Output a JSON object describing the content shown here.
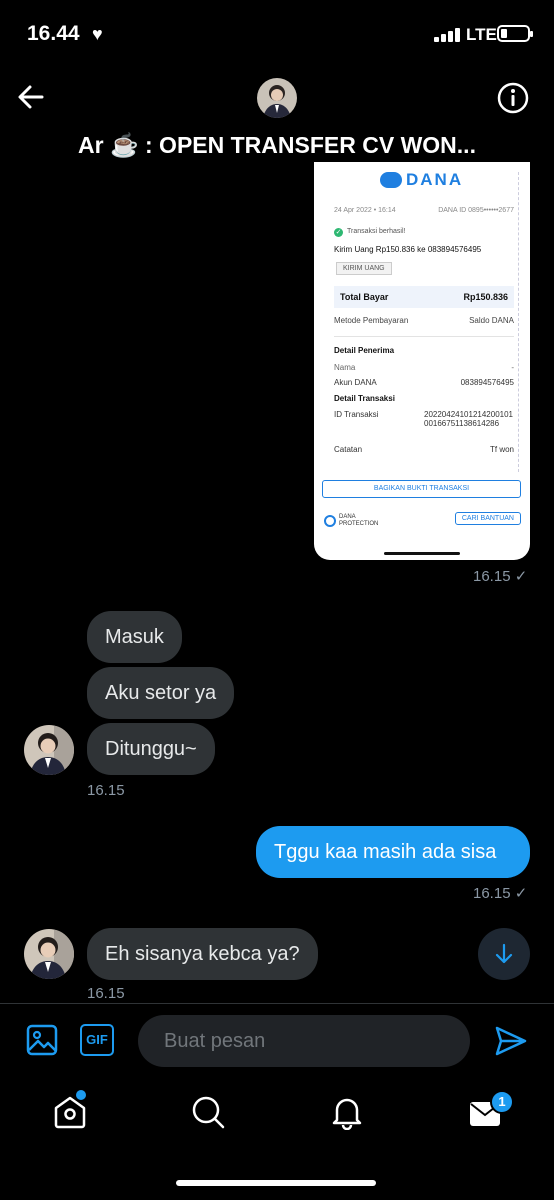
{
  "status": {
    "time": "16.44",
    "network": "LTE"
  },
  "header": {
    "title": "Ar ☕ : OPEN TRANSFER CV WON..."
  },
  "receipt": {
    "brand": "DANA",
    "date": "24 Apr 2022 • 16:14",
    "dana_id": "DANA ID 0895••••••2677",
    "status": "Transaksi berhasil!",
    "summary": "Kirim Uang Rp150.836 ke 083894576495",
    "badge": "KIRIM UANG",
    "total_label": "Total Bayar",
    "total_value": "Rp150.836",
    "method_label": "Metode Pembayaran",
    "method_value": "Saldo DANA",
    "recipient_section": "Detail Penerima",
    "name_label": "Nama",
    "name_value": "-",
    "account_label": "Akun DANA",
    "account_value": "083894576495",
    "transaction_section": "Detail Transaksi",
    "txid_label": "ID Transaksi",
    "txid_value": "2022042410121420010100166751138614286",
    "note_label": "Catatan",
    "note_value": "Tf won",
    "share_button": "BAGIKAN BUKTI TRANSAKSI",
    "protection_line1": "DANA",
    "protection_line2": "PROTECTION",
    "help_button": "CARI BANTUAN"
  },
  "messages": {
    "image_time": "16.15 ✓",
    "m1": "Masuk",
    "m2": "Aku setor ya",
    "m3": "Ditunggu~",
    "group1_time": "16.15",
    "m4": "Tggu kaa masih ada sisa",
    "m4_time": "16.15 ✓",
    "m5": "Eh sisanya kebca ya?",
    "m5_time": "16.15"
  },
  "composer": {
    "gif_label": "GIF",
    "placeholder": "Buat pesan"
  },
  "tabbar": {
    "messages_badge": "1"
  },
  "colors": {
    "accent": "#1d9bf0",
    "bubble_other": "#2f3336",
    "background": "#000000"
  }
}
